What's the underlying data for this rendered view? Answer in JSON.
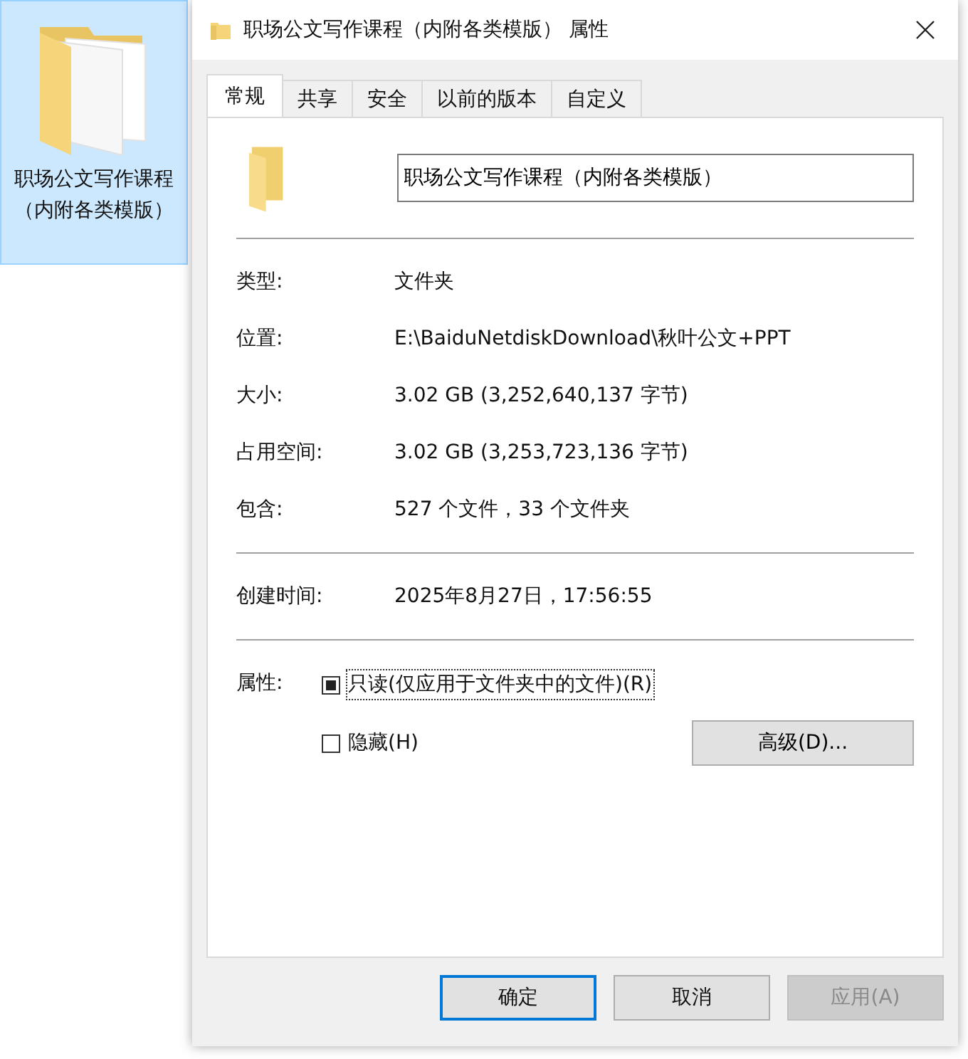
{
  "desktop_icon": {
    "label": "职场公文写作课程（内附各类模版）",
    "selected": true
  },
  "window": {
    "title": "职场公文写作课程（内附各类模版） 属性"
  },
  "tabs": [
    {
      "label": "常规",
      "selected": true
    },
    {
      "label": "共享",
      "selected": false
    },
    {
      "label": "安全",
      "selected": false
    },
    {
      "label": "以前的版本",
      "selected": false
    },
    {
      "label": "自定义",
      "selected": false
    }
  ],
  "name_field": {
    "value": "职场公文写作课程（内附各类模版）"
  },
  "sections": [
    [
      {
        "label": "类型:",
        "value": "文件夹"
      },
      {
        "label": "位置:",
        "value": "E:\\BaiduNetdiskDownload\\秋叶公文+PPT"
      },
      {
        "label": "大小:",
        "value": "3.02 GB (3,252,640,137 字节)"
      },
      {
        "label": "占用空间:",
        "value": "3.02 GB (3,253,723,136 字节)"
      },
      {
        "label": "包含:",
        "value": "527 个文件，33 个文件夹"
      }
    ],
    [
      {
        "label": "创建时间:",
        "value": "2025年8月27日，17:56:55"
      }
    ]
  ],
  "attributes": {
    "label": "属性:",
    "options": [
      {
        "label": "只读(仅应用于文件夹中的文件)(R)",
        "checked": false,
        "indeterminate": true,
        "focused": true
      },
      {
        "label": "隐藏(H)",
        "checked": false,
        "indeterminate": false,
        "focused": false
      }
    ],
    "advanced_button": "高级(D)..."
  },
  "buttons": [
    {
      "label": "确定",
      "default": true,
      "disabled": false
    },
    {
      "label": "取消",
      "default": false,
      "disabled": false
    },
    {
      "label": "应用(A)",
      "default": false,
      "disabled": true
    }
  ]
}
